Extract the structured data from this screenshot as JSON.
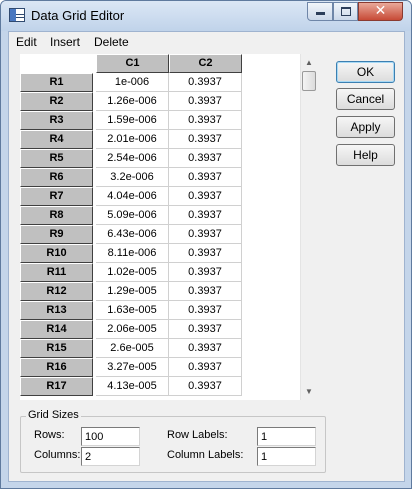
{
  "window": {
    "title": "Data Grid Editor",
    "close_glyph": "✕"
  },
  "menu": [
    "Edit",
    "Insert",
    "Delete"
  ],
  "grid": {
    "columns": [
      "C1",
      "C2"
    ],
    "rows": [
      {
        "label": "R1",
        "c1": "1e-006",
        "c2": "0.3937"
      },
      {
        "label": "R2",
        "c1": "1.26e-006",
        "c2": "0.3937"
      },
      {
        "label": "R3",
        "c1": "1.59e-006",
        "c2": "0.3937"
      },
      {
        "label": "R4",
        "c1": "2.01e-006",
        "c2": "0.3937"
      },
      {
        "label": "R5",
        "c1": "2.54e-006",
        "c2": "0.3937"
      },
      {
        "label": "R6",
        "c1": "3.2e-006",
        "c2": "0.3937"
      },
      {
        "label": "R7",
        "c1": "4.04e-006",
        "c2": "0.3937"
      },
      {
        "label": "R8",
        "c1": "5.09e-006",
        "c2": "0.3937"
      },
      {
        "label": "R9",
        "c1": "6.43e-006",
        "c2": "0.3937"
      },
      {
        "label": "R10",
        "c1": "8.11e-006",
        "c2": "0.3937"
      },
      {
        "label": "R11",
        "c1": "1.02e-005",
        "c2": "0.3937"
      },
      {
        "label": "R12",
        "c1": "1.29e-005",
        "c2": "0.3937"
      },
      {
        "label": "R13",
        "c1": "1.63e-005",
        "c2": "0.3937"
      },
      {
        "label": "R14",
        "c1": "2.06e-005",
        "c2": "0.3937"
      },
      {
        "label": "R15",
        "c1": "2.6e-005",
        "c2": "0.3937"
      },
      {
        "label": "R16",
        "c1": "3.27e-005",
        "c2": "0.3937"
      },
      {
        "label": "R17",
        "c1": "4.13e-005",
        "c2": "0.3937"
      }
    ]
  },
  "buttons": {
    "ok": "OK",
    "cancel": "Cancel",
    "apply": "Apply",
    "help": "Help"
  },
  "grid_sizes": {
    "legend": "Grid Sizes",
    "rows_label": "Rows:",
    "rows_value": "100",
    "columns_label": "Columns:",
    "columns_value": "2",
    "row_labels_label": "Row Labels:",
    "row_labels_value": "1",
    "column_labels_label": "Column Labels:",
    "column_labels_value": "1"
  }
}
